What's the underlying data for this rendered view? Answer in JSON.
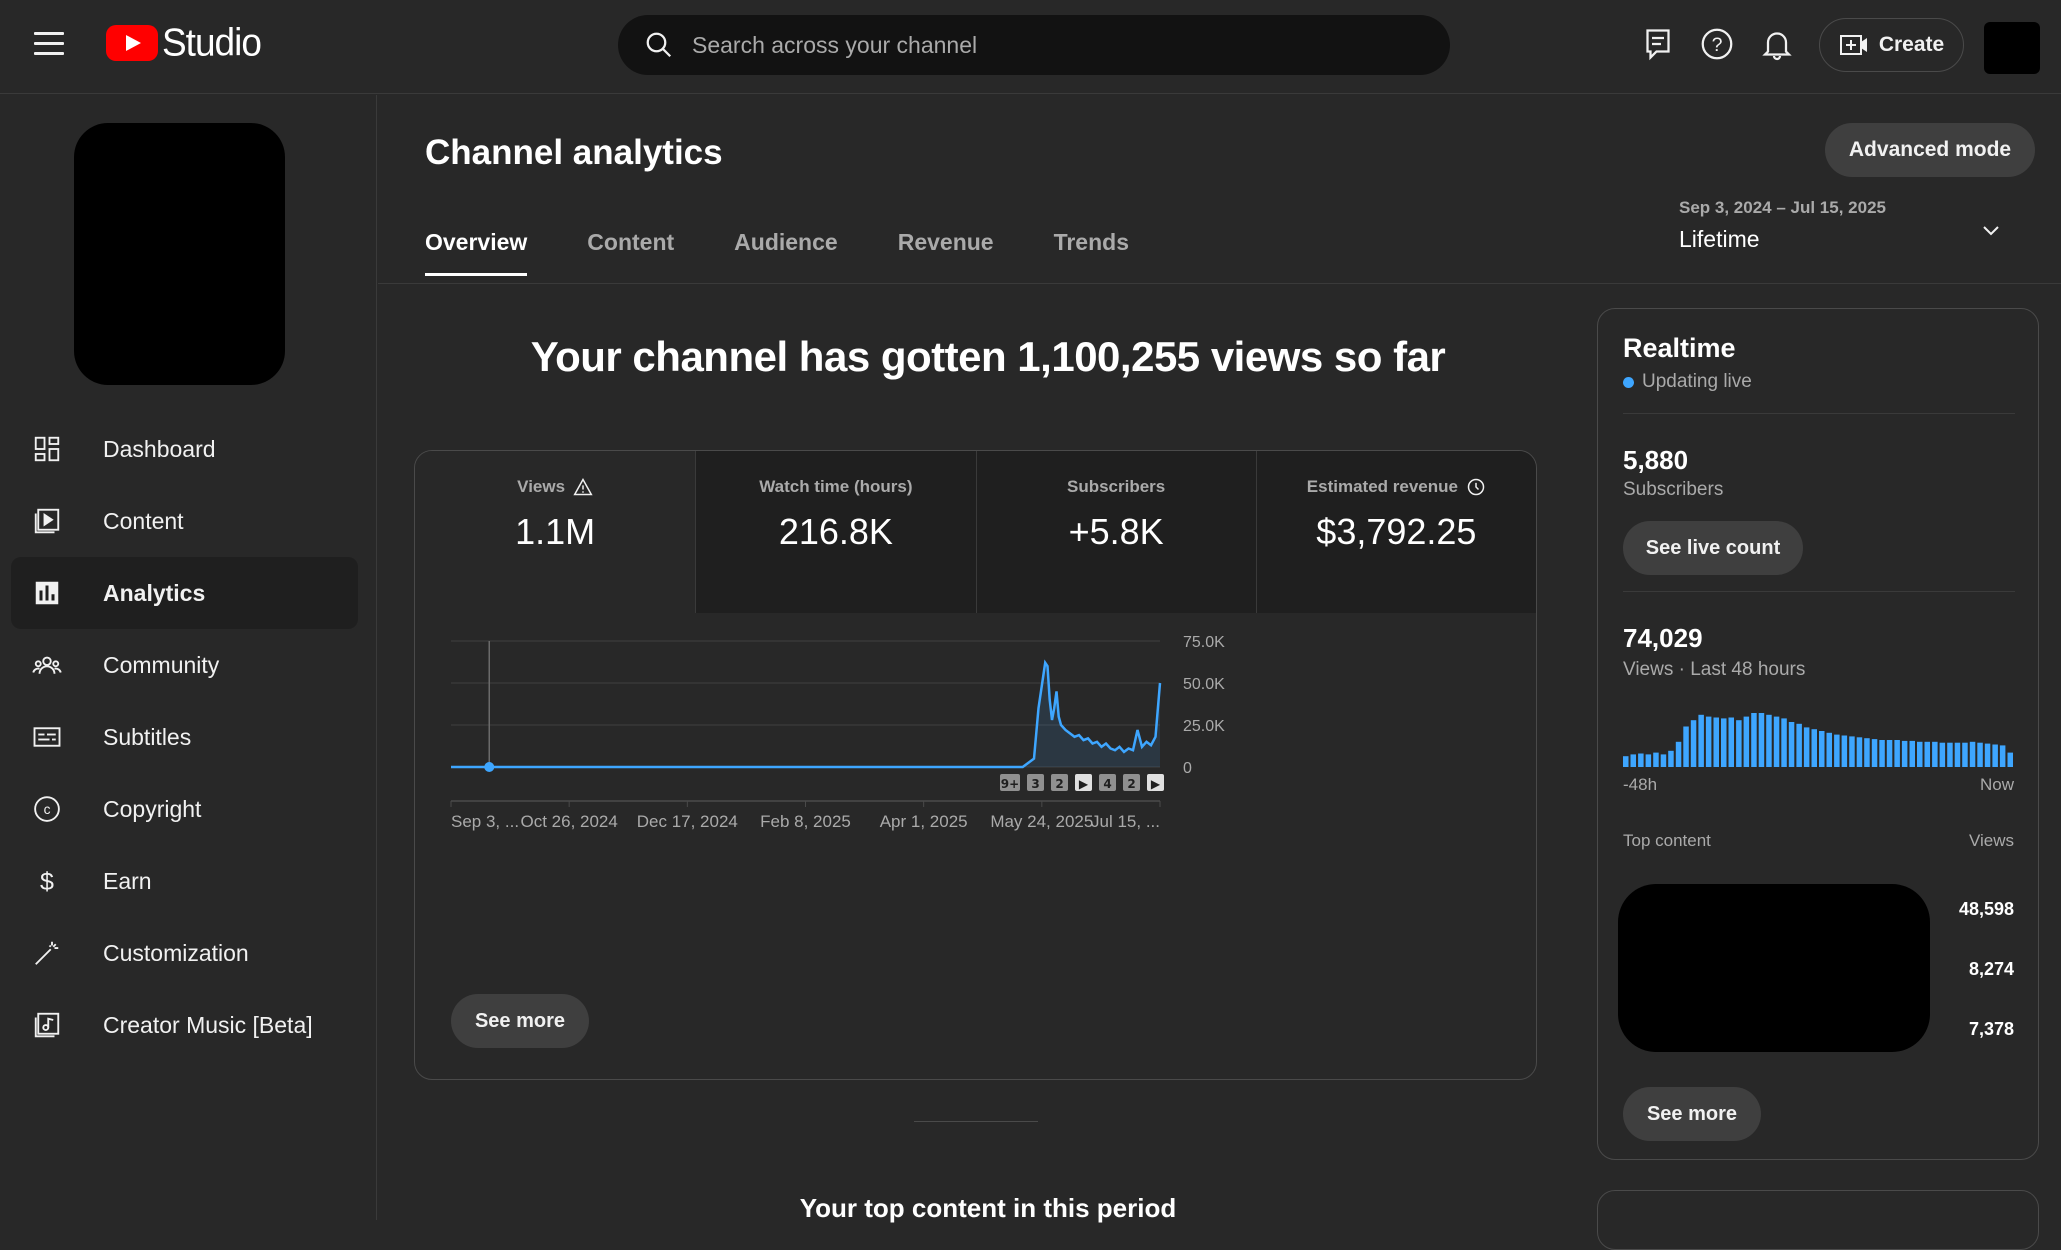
{
  "header": {
    "logo_text": "Studio",
    "search_placeholder": "Search across your channel",
    "create_label": "Create"
  },
  "sidebar": {
    "items": [
      {
        "label": "Dashboard",
        "icon": "dashboard-icon"
      },
      {
        "label": "Content",
        "icon": "content-icon"
      },
      {
        "label": "Analytics",
        "icon": "analytics-icon",
        "active": true
      },
      {
        "label": "Community",
        "icon": "community-icon"
      },
      {
        "label": "Subtitles",
        "icon": "subtitles-icon"
      },
      {
        "label": "Copyright",
        "icon": "copyright-icon"
      },
      {
        "label": "Earn",
        "icon": "earn-icon"
      },
      {
        "label": "Customization",
        "icon": "customization-icon"
      },
      {
        "label": "Creator Music [Beta]",
        "icon": "creator-music-icon"
      }
    ]
  },
  "main": {
    "title": "Channel analytics",
    "advanced_mode_label": "Advanced mode",
    "tabs": [
      {
        "label": "Overview",
        "active": true
      },
      {
        "label": "Content"
      },
      {
        "label": "Audience"
      },
      {
        "label": "Revenue"
      },
      {
        "label": "Trends"
      }
    ],
    "date_range": "Sep 3, 2024 – Jul 15, 2025",
    "date_label": "Lifetime",
    "headline": "Your channel has gotten 1,100,255 views so far",
    "metrics": [
      {
        "label": "Views",
        "value": "1.1M",
        "icon": "warning-icon"
      },
      {
        "label": "Watch time (hours)",
        "value": "216.8K"
      },
      {
        "label": "Subscribers",
        "value": "+5.8K"
      },
      {
        "label": "Estimated revenue",
        "value": "$3,792.25",
        "icon": "clock-icon"
      }
    ],
    "see_more_label": "See more",
    "top_content_title": "Your top content in this period"
  },
  "chart_data": {
    "type": "line",
    "series_name": "Views",
    "x_tick_labels": [
      "Sep 3, ...",
      "Oct 26, 2024",
      "Dec 17, 2024",
      "Feb 8, 2025",
      "Apr 1, 2025",
      "May 24, 2025",
      "Jul 15, ..."
    ],
    "y_tick_labels": [
      "75.0K",
      "50.0K",
      "25.0K",
      "0"
    ],
    "ylim": [
      0,
      75000
    ],
    "color": "#3ea6ff",
    "x_start_date": "2024-09-03",
    "x_end_date": "2025-07-15",
    "points": [
      [
        "2024-09-03",
        0
      ],
      [
        "2024-09-20",
        0
      ],
      [
        "2024-11-01",
        0
      ],
      [
        "2025-01-01",
        0
      ],
      [
        "2025-03-01",
        0
      ],
      [
        "2025-04-20",
        0
      ],
      [
        "2025-05-15",
        0
      ],
      [
        "2025-05-20",
        5000
      ],
      [
        "2025-05-22",
        35000
      ],
      [
        "2025-05-25",
        62000
      ],
      [
        "2025-05-26",
        60000
      ],
      [
        "2025-05-27",
        40000
      ],
      [
        "2025-05-28",
        28000
      ],
      [
        "2025-05-29",
        35000
      ],
      [
        "2025-05-30",
        45000
      ],
      [
        "2025-05-31",
        30000
      ],
      [
        "2025-06-01",
        25000
      ],
      [
        "2025-06-03",
        22000
      ],
      [
        "2025-06-05",
        20000
      ],
      [
        "2025-06-07",
        18000
      ],
      [
        "2025-06-09",
        19000
      ],
      [
        "2025-06-11",
        16000
      ],
      [
        "2025-06-13",
        17000
      ],
      [
        "2025-06-15",
        14000
      ],
      [
        "2025-06-17",
        15000
      ],
      [
        "2025-06-19",
        12000
      ],
      [
        "2025-06-21",
        14000
      ],
      [
        "2025-06-23",
        11000
      ],
      [
        "2025-06-25",
        10000
      ],
      [
        "2025-06-27",
        12000
      ],
      [
        "2025-06-29",
        9000
      ],
      [
        "2025-07-01",
        11000
      ],
      [
        "2025-07-03",
        10000
      ],
      [
        "2025-07-05",
        22000
      ],
      [
        "2025-07-07",
        12000
      ],
      [
        "2025-07-09",
        15000
      ],
      [
        "2025-07-11",
        13000
      ],
      [
        "2025-07-13",
        18000
      ],
      [
        "2025-07-15",
        50000
      ]
    ],
    "markers": [
      "9+",
      "3",
      "2",
      "▶",
      "4",
      "2",
      "▶"
    ]
  },
  "realtime": {
    "title": "Realtime",
    "status": "Updating live",
    "subscribers_value": "5,880",
    "subscribers_label": "Subscribers",
    "see_live_count_label": "See live count",
    "views_value": "74,029",
    "views_label": "Views · Last 48 hours",
    "axis_start": "-48h",
    "axis_end": "Now",
    "bar_values": [
      12,
      14,
      15,
      14,
      16,
      14,
      18,
      28,
      45,
      52,
      58,
      56,
      55,
      54,
      55,
      52,
      56,
      60,
      60,
      58,
      56,
      54,
      50,
      48,
      44,
      42,
      40,
      38,
      36,
      35,
      34,
      33,
      32,
      31,
      30,
      30,
      30,
      29,
      29,
      28,
      28,
      28,
      27,
      27,
      27,
      27,
      28,
      27,
      26,
      25,
      24,
      16
    ],
    "top_content_label": "Top content",
    "views_column_label": "Views",
    "top_content_values": [
      "48,598",
      "8,274",
      "7,378"
    ],
    "see_more_label": "See more"
  }
}
